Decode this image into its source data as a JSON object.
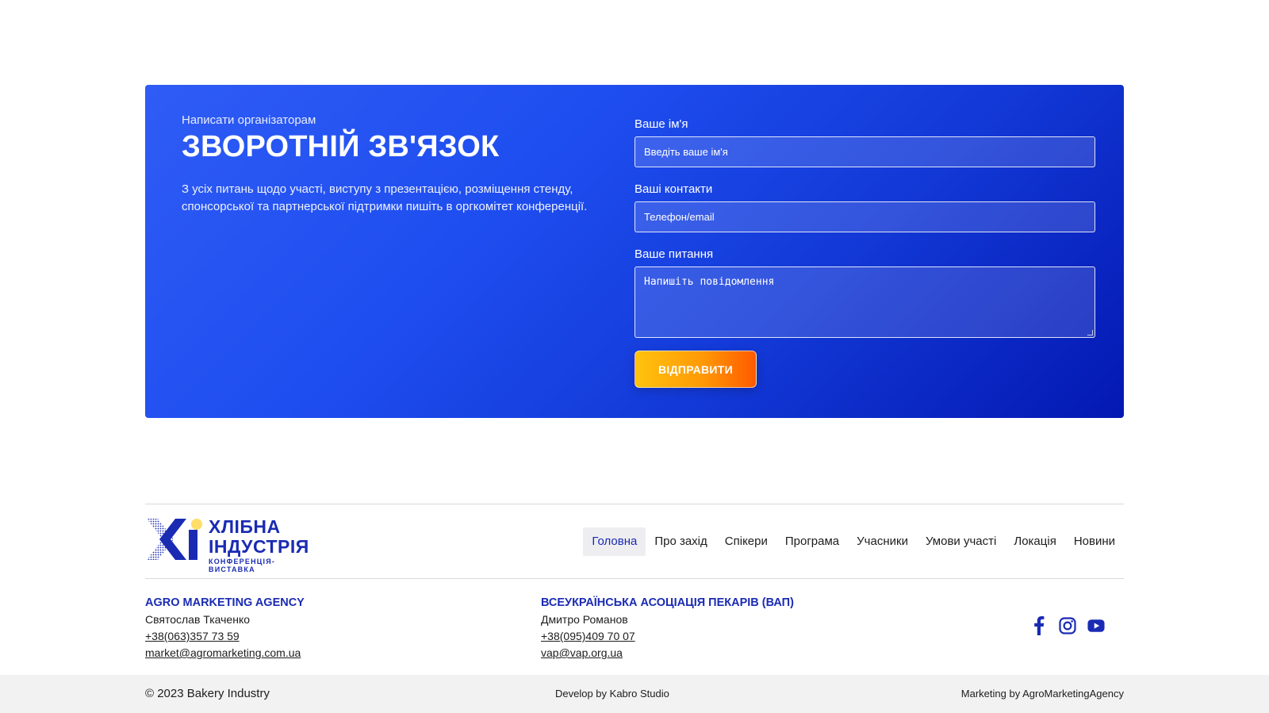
{
  "contact": {
    "eyebrow": "Написати організаторам",
    "title": "ЗВОРОТНІЙ ЗВ'ЯЗОК",
    "description": "З усіх питань щодо участі, виступу з презентацією, розміщення стенду, спонсорської та партнерської підтримки пишіть в оргкомітет конференції.",
    "form": {
      "name_label": "Ваше ім'я",
      "name_placeholder": "Введіть ваше ім'я",
      "contacts_label": "Ваші контакти",
      "contacts_placeholder": "Телефон/email",
      "question_label": "Ваше питання",
      "question_placeholder": "Напишіть повідомлення",
      "submit_label": "ВІДПРАВИТИ"
    }
  },
  "logo": {
    "line1": "ХЛІБНА",
    "line2": "ІНДУСТРІЯ",
    "sub": "КОНФЕРЕНЦІЯ-ВИСТАВКА"
  },
  "nav": {
    "items": [
      "Головна",
      "Про захід",
      "Спікери",
      "Програма",
      "Учасники",
      "Умови участі",
      "Локація",
      "Новини"
    ],
    "active": "Головна"
  },
  "organizers": [
    {
      "name": "AGRO MARKETING AGENCY",
      "person": "Святослав Ткаченко",
      "phone": "+38(063)357 73 59",
      "email": "market@agromarketing.com.ua"
    },
    {
      "name": "ВСЕУКРАЇНСЬКА АСОЦІАЦІЯ ПЕКАРІВ (ВАП)",
      "person": "Дмитро Романов",
      "phone": "+38(095)409 70 07",
      "email": "vap@vap.org.ua"
    }
  ],
  "socials": [
    "facebook-icon",
    "instagram-icon",
    "youtube-icon"
  ],
  "bottom_bar": {
    "copyright": "© 2023 Bakery Industry",
    "develop": "Develop by Kabro Studio",
    "marketing": "Marketing by AgroMarketingAgency"
  },
  "colors": {
    "brand_blue": "#1a2bb3",
    "card_gradient_start": "#2f5cf5",
    "card_gradient_end": "#0418b2",
    "button_gradient_start": "#ffc20e",
    "button_gradient_end": "#ff5a00"
  }
}
